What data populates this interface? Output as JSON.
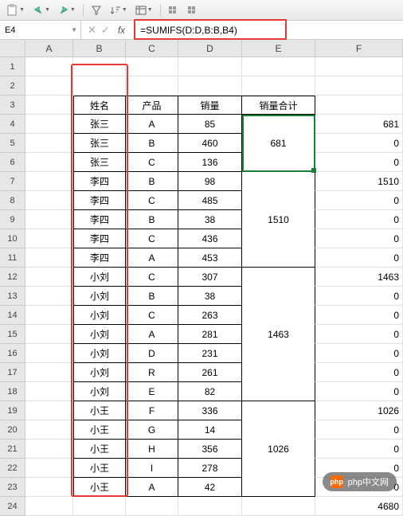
{
  "toolbar": {
    "paste_icon": "paste",
    "undo": "undo",
    "redo": "redo",
    "filter": "filter",
    "sort": "sort",
    "table": "table",
    "more1": "a",
    "more2": "b"
  },
  "name_box": "E4",
  "fx_label": "fx",
  "formula": "=SUMIFS(D:D,B:B,B4)",
  "columns": [
    "A",
    "B",
    "C",
    "D",
    "E",
    "F"
  ],
  "headers": {
    "B": "姓名",
    "C": "产品",
    "D": "销量",
    "E": "销量合计"
  },
  "data_rows": [
    {
      "r": 4,
      "B": "张三",
      "C": "A",
      "D": "85",
      "E": "",
      "F": "681"
    },
    {
      "r": 5,
      "B": "张三",
      "C": "B",
      "D": "460",
      "E": "681",
      "F": "0"
    },
    {
      "r": 6,
      "B": "张三",
      "C": "C",
      "D": "136",
      "E": "",
      "F": "0"
    },
    {
      "r": 7,
      "B": "李四",
      "C": "B",
      "D": "98",
      "E": "",
      "F": "1510"
    },
    {
      "r": 8,
      "B": "李四",
      "C": "C",
      "D": "485",
      "E": "",
      "F": "0"
    },
    {
      "r": 9,
      "B": "李四",
      "C": "B",
      "D": "38",
      "E": "1510",
      "F": "0"
    },
    {
      "r": 10,
      "B": "李四",
      "C": "C",
      "D": "436",
      "E": "",
      "F": "0"
    },
    {
      "r": 11,
      "B": "李四",
      "C": "A",
      "D": "453",
      "E": "",
      "F": "0"
    },
    {
      "r": 12,
      "B": "小刘",
      "C": "C",
      "D": "307",
      "E": "",
      "F": "1463"
    },
    {
      "r": 13,
      "B": "小刘",
      "C": "B",
      "D": "38",
      "E": "",
      "F": "0"
    },
    {
      "r": 14,
      "B": "小刘",
      "C": "C",
      "D": "263",
      "E": "",
      "F": "0"
    },
    {
      "r": 15,
      "B": "小刘",
      "C": "A",
      "D": "281",
      "E": "1463",
      "F": "0"
    },
    {
      "r": 16,
      "B": "小刘",
      "C": "D",
      "D": "231",
      "E": "",
      "F": "0"
    },
    {
      "r": 17,
      "B": "小刘",
      "C": "R",
      "D": "261",
      "E": "",
      "F": "0"
    },
    {
      "r": 18,
      "B": "小刘",
      "C": "E",
      "D": "82",
      "E": "",
      "F": "0"
    },
    {
      "r": 19,
      "B": "小王",
      "C": "F",
      "D": "336",
      "E": "",
      "F": "1026"
    },
    {
      "r": 20,
      "B": "小王",
      "C": "G",
      "D": "14",
      "E": "",
      "F": "0"
    },
    {
      "r": 21,
      "B": "小王",
      "C": "H",
      "D": "356",
      "E": "1026",
      "F": "0"
    },
    {
      "r": 22,
      "B": "小王",
      "C": "I",
      "D": "278",
      "E": "",
      "F": "0"
    },
    {
      "r": 23,
      "B": "小王",
      "C": "A",
      "D": "42",
      "E": "",
      "F": "0"
    }
  ],
  "total_row": {
    "r": 24,
    "F": "4680"
  },
  "merges_E": [
    [
      4,
      6
    ],
    [
      7,
      11
    ],
    [
      12,
      18
    ],
    [
      19,
      23
    ]
  ],
  "watermark": {
    "logo": "php",
    "text": "php中文网"
  }
}
